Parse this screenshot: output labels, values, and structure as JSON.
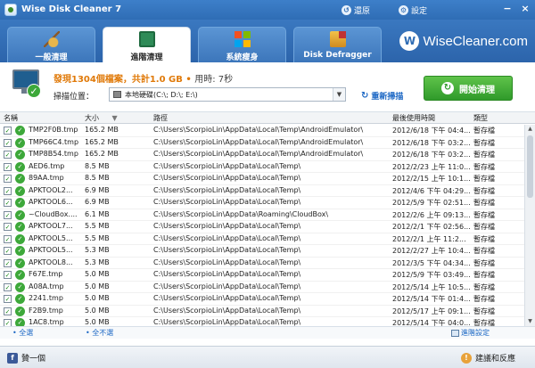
{
  "window": {
    "title": "Wise Disk Cleaner 7",
    "restore_label": "還原",
    "settings_label": "設定"
  },
  "tabs": [
    {
      "label": "一般清理",
      "icon": "broom-icon",
      "active": false
    },
    {
      "label": "進階清理",
      "icon": "scan-icon",
      "active": true
    },
    {
      "label": "系統瘦身",
      "icon": "windows-icon",
      "active": false
    },
    {
      "label": "Disk Defragger",
      "icon": "defrag-icon",
      "active": false
    }
  ],
  "brand": {
    "logo": "W",
    "name": "WiseCleaner.com"
  },
  "scan": {
    "found": "發現1304個檔案，共計1.0 GB",
    "elapsed": "用時: 7秒",
    "location_label": "掃描位置：",
    "location_value": "本地硬碟(C:\\; D:\\; E:\\)",
    "rescan_label": "重新掃描",
    "start_label": "開始清理"
  },
  "table": {
    "columns": [
      "名稱",
      "大小",
      "路徑",
      "最後使用時間",
      "類型"
    ],
    "rows": [
      {
        "name": "TMP2F0B.tmp",
        "size": "165.2 MB",
        "path": "C:\\Users\\ScorpioLin\\AppData\\Local\\Temp\\AndroidEmulator\\",
        "time": "2012/6/18 下午 04:4...",
        "type": "暫存檔"
      },
      {
        "name": "TMP66C4.tmp",
        "size": "165.2 MB",
        "path": "C:\\Users\\ScorpioLin\\AppData\\Local\\Temp\\AndroidEmulator\\",
        "time": "2012/6/18 下午 03:2...",
        "type": "暫存檔"
      },
      {
        "name": "TMP8B54.tmp",
        "size": "165.2 MB",
        "path": "C:\\Users\\ScorpioLin\\AppData\\Local\\Temp\\AndroidEmulator\\",
        "time": "2012/6/18 下午 03:2...",
        "type": "暫存檔"
      },
      {
        "name": "AED6.tmp",
        "size": "8.5 MB",
        "path": "C:\\Users\\ScorpioLin\\AppData\\Local\\Temp\\",
        "time": "2012/2/23 上午 11:0...",
        "type": "暫存檔"
      },
      {
        "name": "89AA.tmp",
        "size": "8.5 MB",
        "path": "C:\\Users\\ScorpioLin\\AppData\\Local\\Temp\\",
        "time": "2012/2/15 上午 10:1...",
        "type": "暫存檔"
      },
      {
        "name": "APKTOOL2...",
        "size": "6.9 MB",
        "path": "C:\\Users\\ScorpioLin\\AppData\\Local\\Temp\\",
        "time": "2012/4/6 下午 04:29...",
        "type": "暫存檔"
      },
      {
        "name": "APKTOOL6...",
        "size": "6.9 MB",
        "path": "C:\\Users\\ScorpioLin\\AppData\\Local\\Temp\\",
        "time": "2012/5/9 下午 02:51...",
        "type": "暫存檔"
      },
      {
        "name": "~CloudBox....",
        "size": "6.1 MB",
        "path": "C:\\Users\\ScorpioLin\\AppData\\Roaming\\CloudBox\\",
        "time": "2012/2/6 上午 09:13...",
        "type": "暫存檔"
      },
      {
        "name": "APKTOOL7...",
        "size": "5.5 MB",
        "path": "C:\\Users\\ScorpioLin\\AppData\\Local\\Temp\\",
        "time": "2012/2/1 下午 02:56...",
        "type": "暫存檔"
      },
      {
        "name": "APKTOOL5...",
        "size": "5.5 MB",
        "path": "C:\\Users\\ScorpioLin\\AppData\\Local\\Temp\\",
        "time": "2012/2/1 上午 11:2...",
        "type": "暫存檔"
      },
      {
        "name": "APKTOOL5...",
        "size": "5.3 MB",
        "path": "C:\\Users\\ScorpioLin\\AppData\\Local\\Temp\\",
        "time": "2012/2/27 上午 10:4...",
        "type": "暫存檔"
      },
      {
        "name": "APKTOOL8...",
        "size": "5.3 MB",
        "path": "C:\\Users\\ScorpioLin\\AppData\\Local\\Temp\\",
        "time": "2012/3/5 下午 04:34...",
        "type": "暫存檔"
      },
      {
        "name": "F67E.tmp",
        "size": "5.0 MB",
        "path": "C:\\Users\\ScorpioLin\\AppData\\Local\\Temp\\",
        "time": "2012/5/9 下午 03:49...",
        "type": "暫存檔"
      },
      {
        "name": "A08A.tmp",
        "size": "5.0 MB",
        "path": "C:\\Users\\ScorpioLin\\AppData\\Local\\Temp\\",
        "time": "2012/5/14 上午 10:5...",
        "type": "暫存檔"
      },
      {
        "name": "2241.tmp",
        "size": "5.0 MB",
        "path": "C:\\Users\\ScorpioLin\\AppData\\Local\\Temp\\",
        "time": "2012/5/14 下午 01:4...",
        "type": "暫存檔"
      },
      {
        "name": "F2B9.tmp",
        "size": "5.0 MB",
        "path": "C:\\Users\\ScorpioLin\\AppData\\Local\\Temp\\",
        "time": "2012/5/17 上午 09:1...",
        "type": "暫存檔"
      },
      {
        "name": "1AC8.tmp",
        "size": "5.0 MB",
        "path": "C:\\Users\\ScorpioLin\\AppData\\Local\\Temp\\",
        "time": "2012/5/14 下午 04:0...",
        "type": "暫存檔"
      }
    ]
  },
  "footer": {
    "select_all": "全選",
    "select_none": "全不選",
    "advanced_settings": "進階設定"
  },
  "status": {
    "like_label": "贊一個",
    "feedback_label": "建議和反應"
  }
}
